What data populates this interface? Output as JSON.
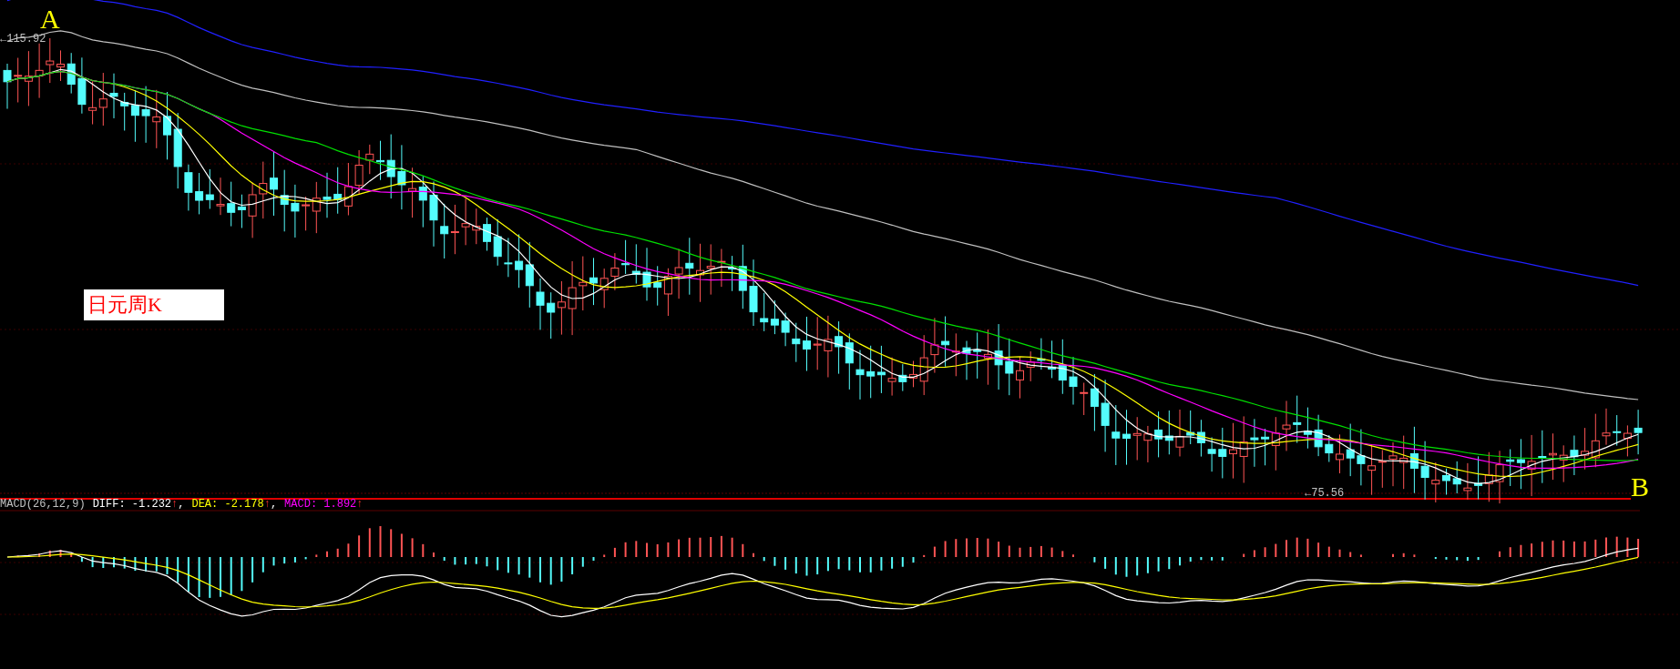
{
  "chart": {
    "point_a_label": "A",
    "high_price": "←115.92",
    "title": "日元周K",
    "point_b_label": "B",
    "low_price": "←75.56"
  },
  "macd_legend": {
    "name": "MACD(26,12,9)",
    "items": [
      {
        "text": "DIFF: -1.232",
        "arrow": "↑",
        "separator": ",",
        "color": "#ffffff"
      },
      {
        "text": "DEA: -2.178",
        "arrow": "↑",
        "separator": ",",
        "color": "#ffff00"
      },
      {
        "text": "MACD: 1.892",
        "arrow": "↑",
        "color": "#ff00ff"
      }
    ]
  }
}
